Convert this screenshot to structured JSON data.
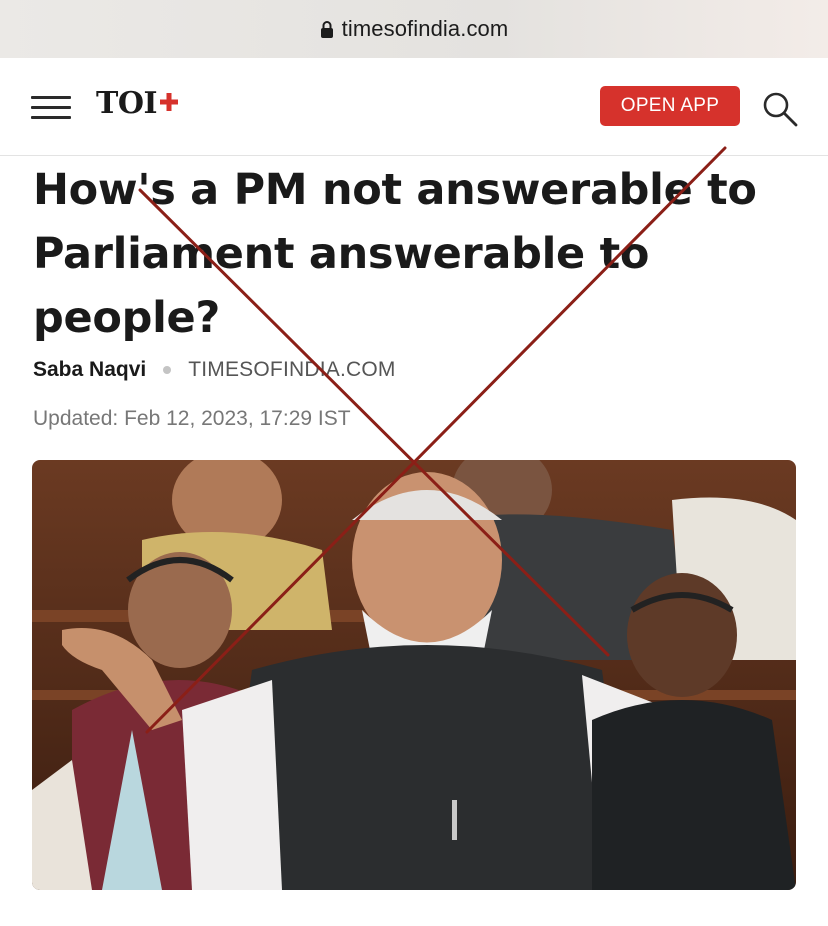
{
  "browser": {
    "domain": "timesofindia.com"
  },
  "header": {
    "logo_text": "TOI",
    "open_app_label": "OPEN APP"
  },
  "article": {
    "headline": "How's a PM not answerable to Parliament answerable to people?",
    "author": "Saba Naqvi",
    "source": "TIMESOFINDIA.COM",
    "updated": "Updated: Feb 12, 2023, 17:29 IST"
  },
  "colors": {
    "brand_red": "#d6322c",
    "cross_line": "#8b1f17"
  },
  "icons": {
    "lock": "lock-icon",
    "menu": "hamburger-menu-icon",
    "plus": "plus-icon",
    "search": "search-icon"
  }
}
